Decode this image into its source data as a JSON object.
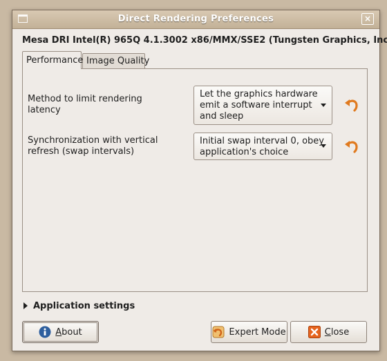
{
  "window": {
    "title": "Direct Rendering Preferences",
    "close_label": "×"
  },
  "driver_info": "Mesa DRI Intel(R) 965Q 4.1.3002 x86/MMX/SSE2 (Tungsten Graphics, Inc)",
  "tabs": [
    {
      "label": "Performance",
      "active": true
    },
    {
      "label": "Image Quality",
      "active": false
    }
  ],
  "settings": [
    {
      "label_line1": "Method to limit rendering",
      "label_line2": "latency",
      "value_line1": "Let the graphics hardware",
      "value_line2": "emit a software interrupt",
      "value_line3": "and sleep",
      "revert_icon": "undo-arrow-icon"
    },
    {
      "label_line1": "Synchronization with vertical",
      "label_line2": "refresh (swap intervals)",
      "value_line1": "Initial swap interval 0, obey",
      "value_line2": "application's choice",
      "revert_icon": "undo-arrow-icon"
    }
  ],
  "expander": {
    "label": "Application settings",
    "expanded": false
  },
  "buttons": {
    "about": {
      "mnemonic": "A",
      "rest": "bout",
      "icon": "info-icon"
    },
    "expert": {
      "label": "Expert Mode",
      "icon": "expert-mode-icon"
    },
    "close": {
      "mnemonic": "C",
      "rest": "lose",
      "icon": "close-x-icon"
    }
  },
  "colors": {
    "accent_orange": "#e07a1f",
    "info_blue": "#2e5f9e"
  }
}
